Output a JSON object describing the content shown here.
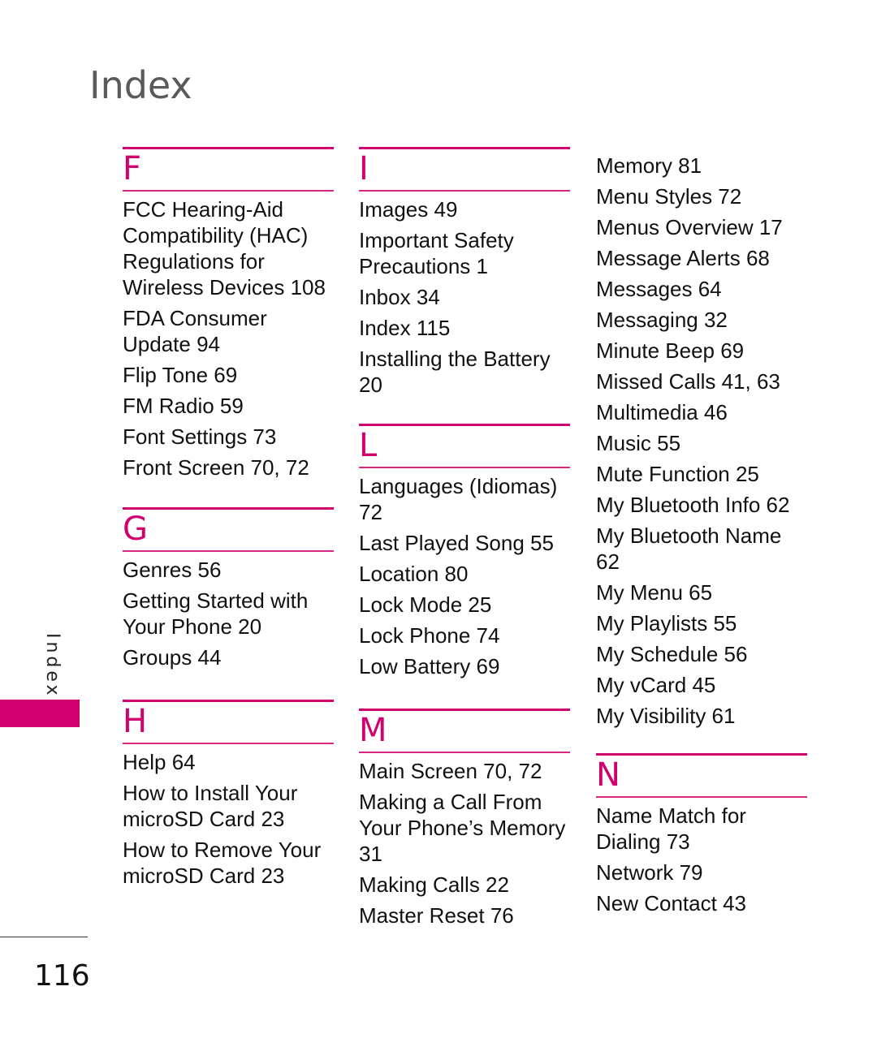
{
  "header": {
    "title": "Index"
  },
  "sidebar": {
    "label": "Index"
  },
  "footer": {
    "page_number": "116"
  },
  "colors": {
    "accent": "#d1006f",
    "title": "#5a5a5a",
    "text": "#111111"
  },
  "sections": {
    "F": {
      "letter": "F",
      "entries": [
        "FCC Hearing-Aid Compatibility (HAC) Regulations for Wireless Devices 108",
        "FDA Consumer Update 94",
        "Flip Tone 69",
        "FM Radio 59",
        "Font Settings 73",
        "Front Screen 70, 72"
      ]
    },
    "G": {
      "letter": "G",
      "entries": [
        "Genres 56",
        "Getting Started with Your Phone 20",
        "Groups 44"
      ]
    },
    "H": {
      "letter": "H",
      "entries": [
        "Help 64",
        "How to Install Your microSD Card 23",
        "How to Remove Your microSD Card 23"
      ]
    },
    "I": {
      "letter": "I",
      "entries": [
        "Images 49",
        "Important Safety Precautions 1",
        "Inbox 34",
        "Index 115",
        "Installing the Battery 20"
      ]
    },
    "L": {
      "letter": "L",
      "entries": [
        "Languages (Idiomas) 72",
        "Last Played Song 55",
        "Location 80",
        "Lock Mode 25",
        "Lock Phone 74",
        "Low Battery 69"
      ]
    },
    "M": {
      "letter": "M",
      "entries": [
        "Main Screen 70, 72",
        "Making a Call From Your Phone’s Memory 31",
        "Making Calls 22",
        "Master Reset 76"
      ]
    },
    "M_cont": {
      "entries": [
        "Memory 81",
        "Menu Styles 72",
        "Menus Overview 17",
        "Message Alerts 68",
        "Messages 64",
        "Messaging 32",
        "Minute Beep 69",
        "Missed Calls 41, 63",
        "Multimedia 46",
        "Music 55",
        "Mute Function 25",
        "My Bluetooth Info 62",
        "My Bluetooth Name 62",
        "My Menu 65",
        "My Playlists 55",
        "My Schedule 56",
        "My vCard 45",
        "My Visibility 61"
      ]
    },
    "N": {
      "letter": "N",
      "entries": [
        "Name Match for Dialing 73",
        "Network 79",
        "New Contact 43"
      ]
    }
  }
}
